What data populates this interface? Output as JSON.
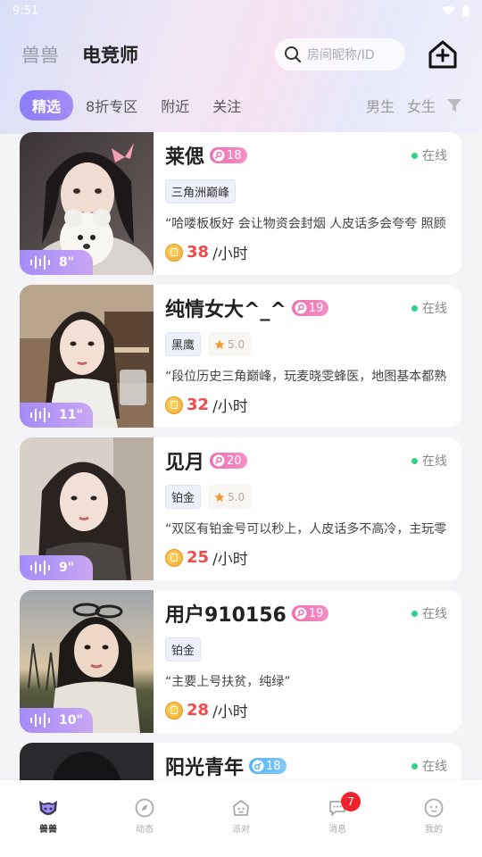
{
  "status": {
    "time": "9:51"
  },
  "header": {
    "tabs": [
      "兽兽",
      "电竞师"
    ],
    "search_placeholder": "房间昵称/ID"
  },
  "filters": {
    "chips": [
      "精选",
      "8折专区",
      "附近",
      "关注"
    ],
    "genders": [
      "男生",
      "女生"
    ]
  },
  "cards": [
    {
      "name": "莱偲",
      "age": "18",
      "gender": "female",
      "online": "在线",
      "tags": [
        "三角洲巅峰"
      ],
      "rating": "",
      "desc": "“哈喽板板好 会让物资会封烟 人皮话多会夸夸 照顾",
      "price": "38",
      "unit": "/小时",
      "voice": "8\""
    },
    {
      "name": "纯情女大^_^",
      "age": "19",
      "gender": "female",
      "online": "在线",
      "tags": [
        "黑鹰"
      ],
      "rating": "5.0",
      "desc": "“段位历史三角巅峰，玩麦晓雯蜂医，地图基本都熟",
      "price": "32",
      "unit": "/小时",
      "voice": "11\""
    },
    {
      "name": "见月",
      "age": "20",
      "gender": "female",
      "online": "在线",
      "tags": [
        "铂金"
      ],
      "rating": "5.0",
      "desc": "“双区有铂金号可以秒上，人皮话多不高冷，主玩零",
      "price": "25",
      "unit": "/小时",
      "voice": "9\""
    },
    {
      "name": "用户910156",
      "age": "19",
      "gender": "female",
      "online": "在线",
      "tags": [
        "铂金"
      ],
      "rating": "",
      "desc": "“主要上号扶贫，纯绿”",
      "price": "28",
      "unit": "/小时",
      "voice": "10\""
    },
    {
      "name": "阳光青年",
      "age": "18",
      "gender": "male",
      "online": "在线",
      "tags": [],
      "rating": "",
      "desc": "",
      "price": "",
      "unit": "",
      "voice": ""
    }
  ],
  "nav": [
    {
      "label": "兽兽",
      "icon": "beast-icon"
    },
    {
      "label": "动态",
      "icon": "compass-icon"
    },
    {
      "label": "派对",
      "icon": "party-icon"
    },
    {
      "label": "消息",
      "icon": "message-icon",
      "badge": "7"
    },
    {
      "label": "我的",
      "icon": "profile-icon"
    }
  ],
  "colors": {
    "accent": "#8b7cf6",
    "price": "#f04a4a",
    "online": "#2fd18b",
    "female_badge": "#ee6fb1",
    "male_badge": "#54b5f3",
    "msg_badge": "#f0232c"
  }
}
